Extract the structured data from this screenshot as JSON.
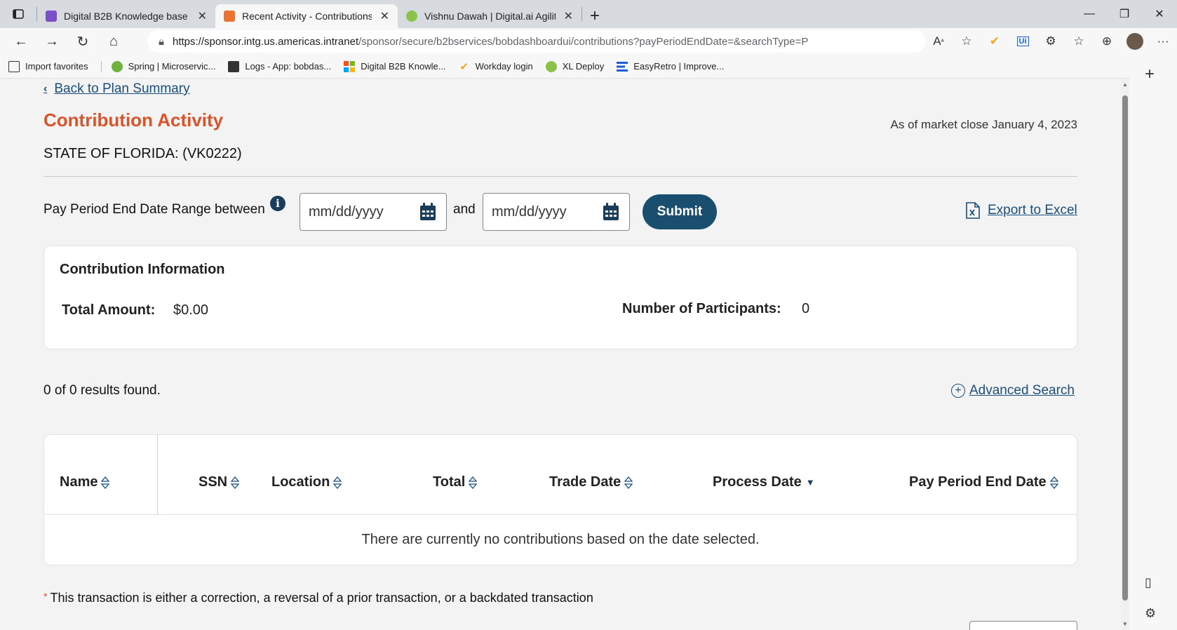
{
  "browser": {
    "tabs": [
      {
        "label": "Digital B2B Knowledge base",
        "favicon_color": "#7b4fc7"
      },
      {
        "label": "Recent Activity - Contributions",
        "favicon_color": "#e8742f"
      },
      {
        "label": "Vishnu Dawah | Digital.ai Agility",
        "favicon_color": "#8bc34a"
      }
    ],
    "url_host": "https://sponsor.intg.us.americas.intranet",
    "url_path": "/sponsor/secure/b2bservices/bobdashboardui/contributions?payPeriodEndDate=&searchType=P",
    "favorites": [
      {
        "label": "Import favorites",
        "icon": "import-icon"
      },
      {
        "label": "Spring | Microservic...",
        "icon": "spring-icon",
        "color": "#6db33f"
      },
      {
        "label": "Logs - App: bobdas...",
        "icon": "logs-icon",
        "color": "#333333"
      },
      {
        "label": "Digital B2B Knowle...",
        "icon": "windows-icon"
      },
      {
        "label": "Workday login",
        "icon": "workday-icon",
        "color": "#f5a623"
      },
      {
        "label": "XL Deploy",
        "icon": "xl-deploy-icon",
        "color": "#8bc34a"
      },
      {
        "label": "EasyRetro | Improve...",
        "icon": "easyretro-icon",
        "color": "#1e5dd6"
      }
    ]
  },
  "page": {
    "back_link": "Back to Plan Summary",
    "title": "Contribution Activity",
    "as_of": "As of market close January 4, 2023",
    "plan_name": "STATE OF FLORIDA: (VK0222)",
    "filter": {
      "range_label": "Pay Period End Date Range between",
      "start_placeholder": "mm/dd/yyyy",
      "and_label": "and",
      "end_placeholder": "mm/dd/yyyy",
      "submit_label": "Submit",
      "export_label": "Export to Excel"
    },
    "contribution_info": {
      "title": "Contribution Information",
      "total_amount_label": "Total Amount:",
      "total_amount_value": "$0.00",
      "participants_label": "Number of Participants:",
      "participants_value": "0"
    },
    "results_text": "0 of 0 results found.",
    "advanced_search_label": "Advanced Search",
    "table": {
      "columns": [
        "Name",
        "SSN",
        "Location",
        "Total",
        "Trade Date",
        "Process Date",
        "Pay Period End Date"
      ],
      "empty_message": "There are currently no contributions based on the date selected."
    },
    "footnote": "This transaction is either a correction, a reversal of a prior transaction, or a backdated transaction",
    "colors": {
      "accent": "#d9542b",
      "primary": "#1a4e6e",
      "link": "#1a4e7a"
    }
  }
}
